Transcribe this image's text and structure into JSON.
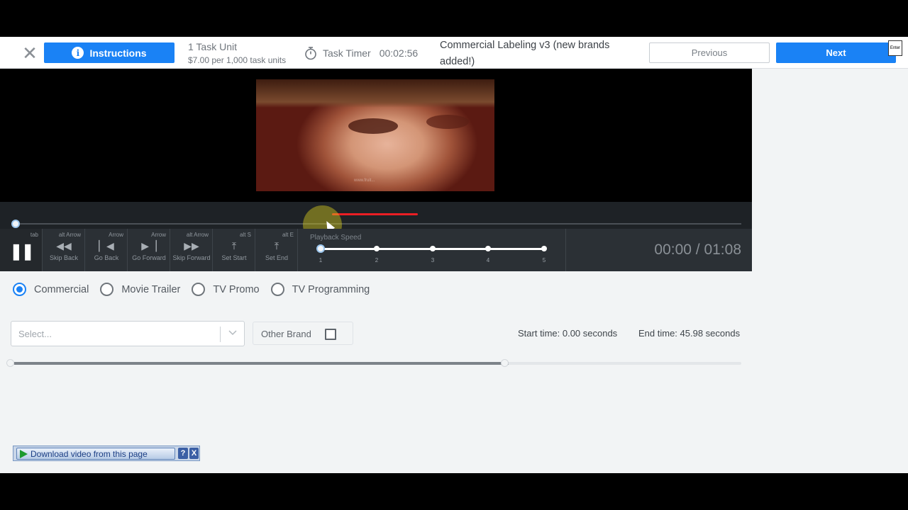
{
  "header": {
    "instructions_label": "Instructions",
    "task_unit_title": "1 Task Unit",
    "task_unit_rate": "$7.00 per 1,000 task units",
    "timer_label": "Task Timer",
    "timer_value": "00:02:56",
    "task_title": "Commercial Labeling v3 (new brands added!)",
    "previous_label": "Previous",
    "next_label": "Next",
    "enter_key": "Enter"
  },
  "video": {
    "watermark": "www.fruit..."
  },
  "controls": {
    "buttons": [
      {
        "hotkey": "tab",
        "label": ""
      },
      {
        "hotkey": "alt Arrow",
        "label": "Skip Back"
      },
      {
        "hotkey": "Arrow",
        "label": "Go Back"
      },
      {
        "hotkey": "Arrow",
        "label": "Go Forward"
      },
      {
        "hotkey": "alt Arrow",
        "label": "Skip Forward"
      },
      {
        "hotkey": "alt S",
        "label": "Set Start"
      },
      {
        "hotkey": "alt E",
        "label": "Set End"
      }
    ],
    "playback_speed_label": "Playback Speed",
    "speed_ticks": [
      "1",
      "2",
      "3",
      "4",
      "5"
    ],
    "speed_value": 1,
    "timecode": "00:00 / 01:08",
    "progress_fraction": 0.0
  },
  "form": {
    "radios": [
      {
        "label": "Commercial",
        "checked": true
      },
      {
        "label": "Movie Trailer",
        "checked": false
      },
      {
        "label": "TV Promo",
        "checked": false
      },
      {
        "label": "TV Programming",
        "checked": false
      }
    ],
    "select_placeholder": "Select...",
    "other_brand_label": "Other Brand",
    "other_brand_checked": false,
    "start_time": "Start time: 0.00 seconds",
    "end_time": "End time: 45.98 seconds",
    "range_start_fraction": 0.0,
    "range_end_fraction": 0.676
  },
  "download_bar": {
    "label": "Download video from this page",
    "help": "?",
    "close": "X"
  },
  "colors": {
    "accent": "#1a82f5",
    "marker_red": "#ea1e24"
  }
}
